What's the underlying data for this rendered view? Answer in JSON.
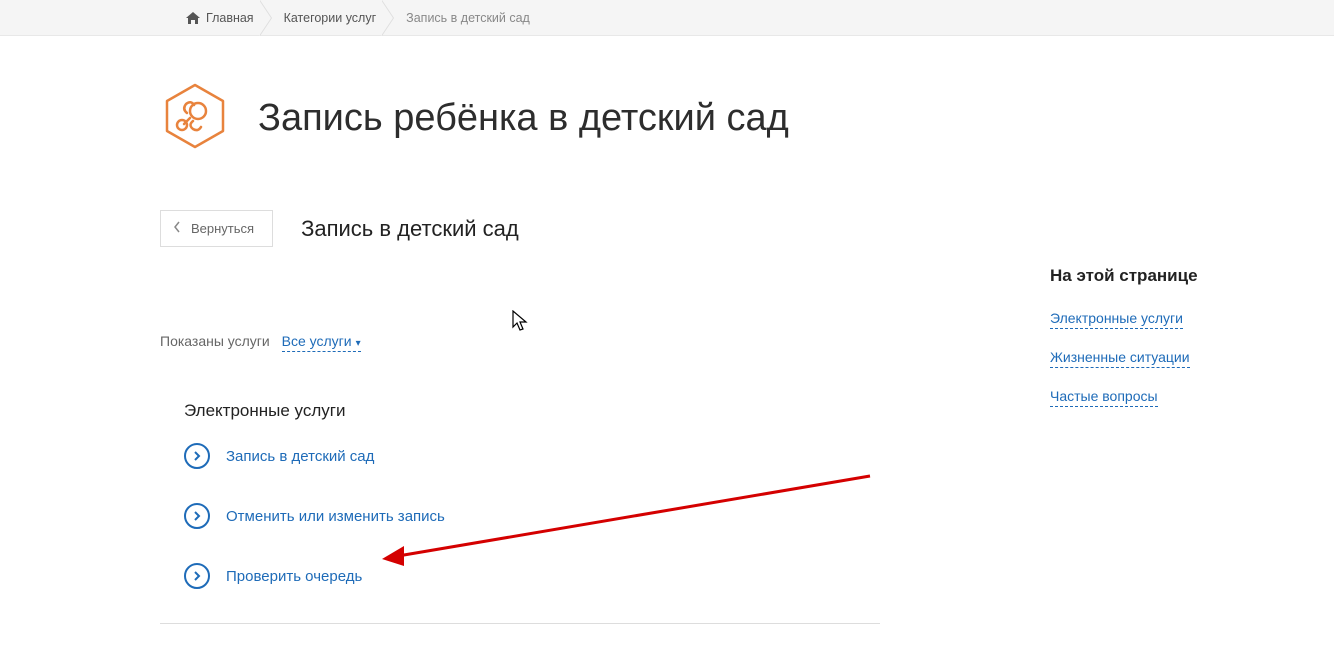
{
  "breadcrumb": {
    "home": "Главная",
    "categories": "Категории услуг",
    "current": "Запись в детский сад"
  },
  "page": {
    "title": "Запись ребёнка в детский сад",
    "back_button": "Вернуться",
    "sub_title": "Запись в детский сад"
  },
  "filter": {
    "label": "Показаны услуги",
    "dropdown": "Все услуги"
  },
  "main": {
    "section_title": "Электронные услуги",
    "services": [
      {
        "label": "Запись в детский сад"
      },
      {
        "label": "Отменить или изменить запись"
      },
      {
        "label": "Проверить очередь"
      }
    ]
  },
  "sidebar": {
    "title": "На этой странице",
    "links": [
      {
        "label": "Электронные услуги"
      },
      {
        "label": "Жизненные ситуации"
      },
      {
        "label": "Частые вопросы"
      }
    ]
  },
  "colors": {
    "accent_orange": "#e8833d",
    "link_blue": "#1e6bb8"
  }
}
